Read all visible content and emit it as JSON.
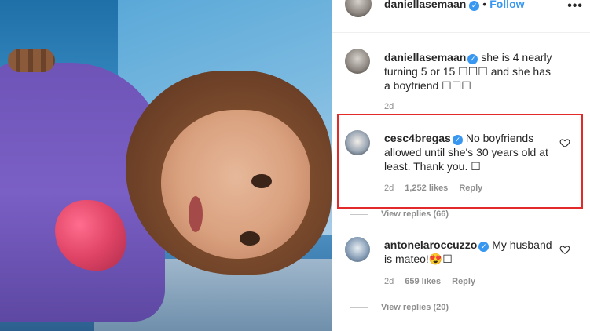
{
  "post": {
    "owner_username": "daniellasemaan",
    "follow_label": "Follow",
    "separator": "•",
    "more_label": "•••"
  },
  "comments": [
    {
      "username": "daniellasemaan",
      "verified": true,
      "text": "she is 4 nearly turning 5 or 15 ☐☐☐ and she has a boyfriend ☐☐☐",
      "age": "2d"
    },
    {
      "username": "cesc4bregas",
      "verified": true,
      "text": "No boyfriends allowed until she's 30 years old at least. Thank you. ☐",
      "age": "2d",
      "likes": "1,252 likes",
      "reply_label": "Reply",
      "view_replies": "View replies (66)",
      "highlighted": true
    },
    {
      "username": "antonelaroccuzzo",
      "verified": true,
      "text": "My husband is mateo!😍☐",
      "age": "2d",
      "likes": "659 likes",
      "reply_label": "Reply",
      "view_replies": "View replies (20)"
    }
  ],
  "colors": {
    "accent": "#3897f0",
    "highlight": "#e32a2a",
    "muted": "#8e8e8e"
  },
  "icons": [
    "verified-badge-icon",
    "heart-icon",
    "more-options-icon"
  ]
}
